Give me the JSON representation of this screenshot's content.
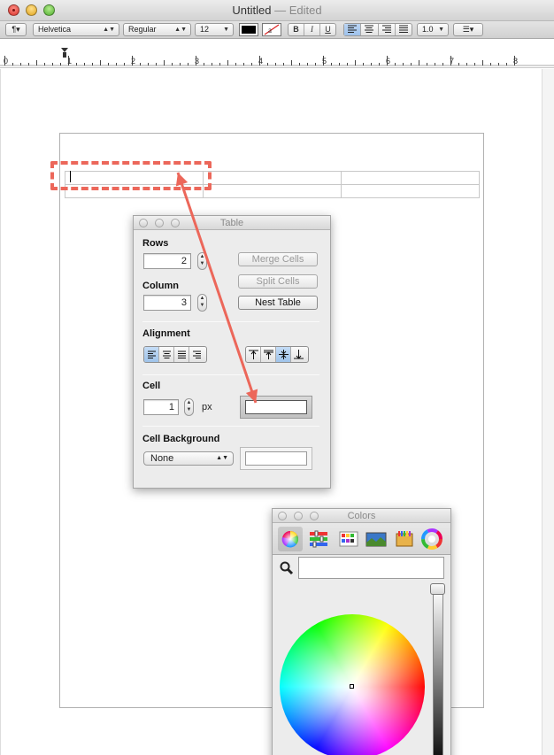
{
  "window": {
    "title": "Untitled",
    "status": "— Edited"
  },
  "toolbar": {
    "paragraph_style": "¶▾",
    "font_family": "Helvetica",
    "font_typeface": "Regular",
    "font_size": "12",
    "bold_label": "B",
    "italic_label": "I",
    "underline_label": "U",
    "line_spacing": "1.0",
    "list_label": "☰▾",
    "text_color": "#000000",
    "alignment_selected": "left"
  },
  "ruler": {
    "numbers": [
      "0",
      "1",
      "2",
      "3",
      "4",
      "5",
      "6",
      "7",
      "8"
    ]
  },
  "document": {
    "table": {
      "rows": 2,
      "columns": 3
    }
  },
  "table_panel": {
    "title": "Table",
    "rows_label": "Rows",
    "rows_value": "2",
    "column_label": "Column",
    "column_value": "3",
    "merge_cells_label": "Merge Cells",
    "split_cells_label": "Split Cells",
    "nest_table_label": "Nest Table",
    "alignment_label": "Alignment",
    "cell_label": "Cell",
    "cell_border_value": "1",
    "cell_border_unit": "px",
    "cell_background_label": "Cell Background",
    "cell_background_value": "None"
  },
  "colors_panel": {
    "title": "Colors",
    "tabs": [
      "color-wheel",
      "color-sliders",
      "color-palettes",
      "image-palettes",
      "crayons",
      "custom-picker"
    ],
    "selected_tab": "color-wheel",
    "search_placeholder": ""
  },
  "annotation": {
    "color": "#ec675a"
  }
}
